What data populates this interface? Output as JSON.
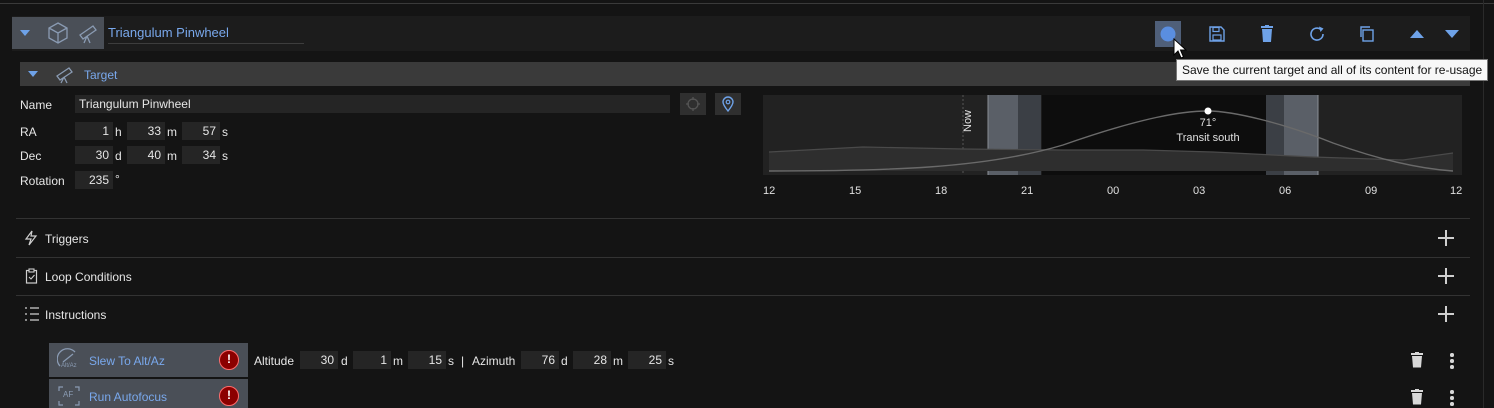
{
  "header": {
    "title": "Triangulum Pinwheel",
    "tooltip": "Save the current target and all of its content for re-usage"
  },
  "target": {
    "section_label": "Target",
    "name_label": "Name",
    "name_value": "Triangulum Pinwheel",
    "ra_label": "RA",
    "ra": {
      "h": "1",
      "h_unit": "h",
      "m": "33",
      "m_unit": "m",
      "s": "57",
      "s_unit": "s"
    },
    "dec_label": "Dec",
    "dec": {
      "d": "30",
      "d_unit": "d",
      "m": "40",
      "m_unit": "m",
      "s": "34",
      "s_unit": "s"
    },
    "rotation_label": "Rotation",
    "rotation_value": "235",
    "rotation_unit": "°"
  },
  "altitude_chart": {
    "now_label": "Now",
    "peak_label": "71°",
    "transit_label": "Transit south",
    "x_ticks": [
      "12",
      "15",
      "18",
      "21",
      "00",
      "03",
      "06",
      "09",
      "12"
    ]
  },
  "sections": {
    "triggers": "Triggers",
    "loop_conditions": "Loop Conditions",
    "instructions": "Instructions"
  },
  "instructions": [
    {
      "name": "Slew To Alt/Az",
      "icon_label": "Alt/Az",
      "warning": "!",
      "altitude_label": "Altitude",
      "alt_d": "30",
      "alt_d_unit": "d",
      "alt_m": "1",
      "alt_m_unit": "m",
      "alt_s": "15",
      "alt_s_unit": "s",
      "separator": "|",
      "azimuth_label": "Azimuth",
      "az_d": "76",
      "az_d_unit": "d",
      "az_m": "28",
      "az_m_unit": "m",
      "az_s": "25",
      "az_s_unit": "s"
    },
    {
      "name": "Run Autofocus",
      "icon_label": "AF",
      "warning": "!"
    }
  ],
  "colors": {
    "accent": "#79a8ec",
    "header_bg": "#4a4f57",
    "warning": "#8b0000"
  }
}
